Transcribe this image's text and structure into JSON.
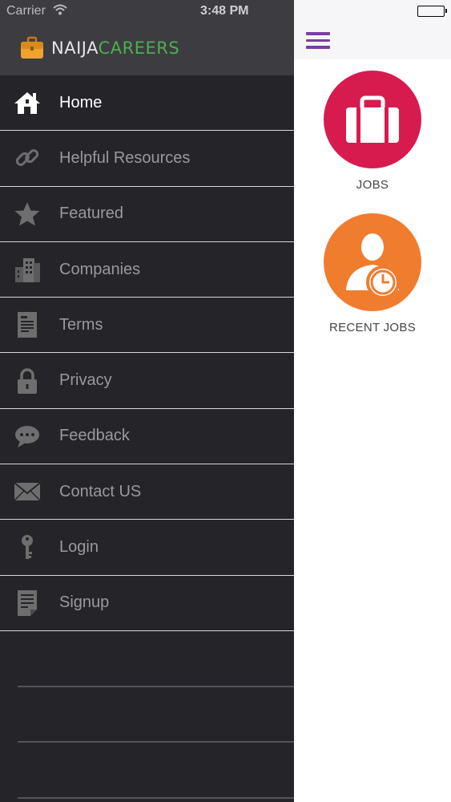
{
  "status_bar": {
    "carrier": "Carrier",
    "time": "3:48 PM"
  },
  "brand": {
    "part1": "NAIJA",
    "part2": "CAREERS",
    "accent_color": "#4caf50"
  },
  "menu": {
    "items": [
      {
        "label": "Home",
        "icon": "home-icon",
        "active": true
      },
      {
        "label": "Helpful Resources",
        "icon": "link-icon"
      },
      {
        "label": "Featured",
        "icon": "star-icon"
      },
      {
        "label": "Companies",
        "icon": "buildings-icon"
      },
      {
        "label": "Terms",
        "icon": "document-icon"
      },
      {
        "label": "Privacy",
        "icon": "lock-icon"
      },
      {
        "label": "Feedback",
        "icon": "chat-bubble-icon"
      },
      {
        "label": "Contact US",
        "icon": "envelope-icon"
      },
      {
        "label": "Login",
        "icon": "key-icon"
      },
      {
        "label": "Signup",
        "icon": "form-icon"
      }
    ]
  },
  "main": {
    "tiles": [
      {
        "label": "JOBS",
        "icon": "briefcase-icon",
        "color": "#d81b4f"
      },
      {
        "label": "RECENT JOBS",
        "icon": "person-clock-icon",
        "color": "#f07c2e"
      }
    ],
    "menu_color": "#7b3fa0"
  }
}
